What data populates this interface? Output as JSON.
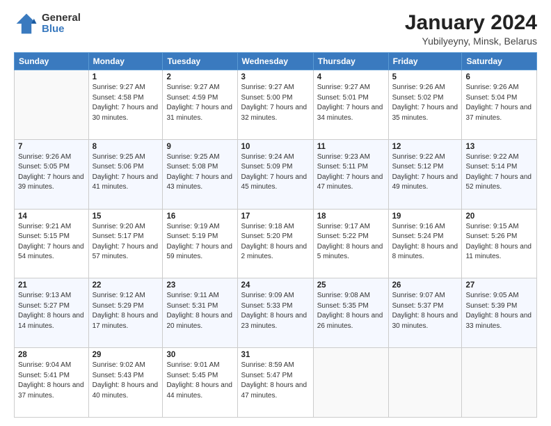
{
  "logo": {
    "general": "General",
    "blue": "Blue"
  },
  "header": {
    "title": "January 2024",
    "subtitle": "Yubilyeyny, Minsk, Belarus"
  },
  "weekdays": [
    "Sunday",
    "Monday",
    "Tuesday",
    "Wednesday",
    "Thursday",
    "Friday",
    "Saturday"
  ],
  "weeks": [
    [
      {
        "day": "",
        "sunrise": "",
        "sunset": "",
        "daylight": ""
      },
      {
        "day": "1",
        "sunrise": "Sunrise: 9:27 AM",
        "sunset": "Sunset: 4:58 PM",
        "daylight": "Daylight: 7 hours and 30 minutes."
      },
      {
        "day": "2",
        "sunrise": "Sunrise: 9:27 AM",
        "sunset": "Sunset: 4:59 PM",
        "daylight": "Daylight: 7 hours and 31 minutes."
      },
      {
        "day": "3",
        "sunrise": "Sunrise: 9:27 AM",
        "sunset": "Sunset: 5:00 PM",
        "daylight": "Daylight: 7 hours and 32 minutes."
      },
      {
        "day": "4",
        "sunrise": "Sunrise: 9:27 AM",
        "sunset": "Sunset: 5:01 PM",
        "daylight": "Daylight: 7 hours and 34 minutes."
      },
      {
        "day": "5",
        "sunrise": "Sunrise: 9:26 AM",
        "sunset": "Sunset: 5:02 PM",
        "daylight": "Daylight: 7 hours and 35 minutes."
      },
      {
        "day": "6",
        "sunrise": "Sunrise: 9:26 AM",
        "sunset": "Sunset: 5:04 PM",
        "daylight": "Daylight: 7 hours and 37 minutes."
      }
    ],
    [
      {
        "day": "7",
        "sunrise": "Sunrise: 9:26 AM",
        "sunset": "Sunset: 5:05 PM",
        "daylight": "Daylight: 7 hours and 39 minutes."
      },
      {
        "day": "8",
        "sunrise": "Sunrise: 9:25 AM",
        "sunset": "Sunset: 5:06 PM",
        "daylight": "Daylight: 7 hours and 41 minutes."
      },
      {
        "day": "9",
        "sunrise": "Sunrise: 9:25 AM",
        "sunset": "Sunset: 5:08 PM",
        "daylight": "Daylight: 7 hours and 43 minutes."
      },
      {
        "day": "10",
        "sunrise": "Sunrise: 9:24 AM",
        "sunset": "Sunset: 5:09 PM",
        "daylight": "Daylight: 7 hours and 45 minutes."
      },
      {
        "day": "11",
        "sunrise": "Sunrise: 9:23 AM",
        "sunset": "Sunset: 5:11 PM",
        "daylight": "Daylight: 7 hours and 47 minutes."
      },
      {
        "day": "12",
        "sunrise": "Sunrise: 9:22 AM",
        "sunset": "Sunset: 5:12 PM",
        "daylight": "Daylight: 7 hours and 49 minutes."
      },
      {
        "day": "13",
        "sunrise": "Sunrise: 9:22 AM",
        "sunset": "Sunset: 5:14 PM",
        "daylight": "Daylight: 7 hours and 52 minutes."
      }
    ],
    [
      {
        "day": "14",
        "sunrise": "Sunrise: 9:21 AM",
        "sunset": "Sunset: 5:15 PM",
        "daylight": "Daylight: 7 hours and 54 minutes."
      },
      {
        "day": "15",
        "sunrise": "Sunrise: 9:20 AM",
        "sunset": "Sunset: 5:17 PM",
        "daylight": "Daylight: 7 hours and 57 minutes."
      },
      {
        "day": "16",
        "sunrise": "Sunrise: 9:19 AM",
        "sunset": "Sunset: 5:19 PM",
        "daylight": "Daylight: 7 hours and 59 minutes."
      },
      {
        "day": "17",
        "sunrise": "Sunrise: 9:18 AM",
        "sunset": "Sunset: 5:20 PM",
        "daylight": "Daylight: 8 hours and 2 minutes."
      },
      {
        "day": "18",
        "sunrise": "Sunrise: 9:17 AM",
        "sunset": "Sunset: 5:22 PM",
        "daylight": "Daylight: 8 hours and 5 minutes."
      },
      {
        "day": "19",
        "sunrise": "Sunrise: 9:16 AM",
        "sunset": "Sunset: 5:24 PM",
        "daylight": "Daylight: 8 hours and 8 minutes."
      },
      {
        "day": "20",
        "sunrise": "Sunrise: 9:15 AM",
        "sunset": "Sunset: 5:26 PM",
        "daylight": "Daylight: 8 hours and 11 minutes."
      }
    ],
    [
      {
        "day": "21",
        "sunrise": "Sunrise: 9:13 AM",
        "sunset": "Sunset: 5:27 PM",
        "daylight": "Daylight: 8 hours and 14 minutes."
      },
      {
        "day": "22",
        "sunrise": "Sunrise: 9:12 AM",
        "sunset": "Sunset: 5:29 PM",
        "daylight": "Daylight: 8 hours and 17 minutes."
      },
      {
        "day": "23",
        "sunrise": "Sunrise: 9:11 AM",
        "sunset": "Sunset: 5:31 PM",
        "daylight": "Daylight: 8 hours and 20 minutes."
      },
      {
        "day": "24",
        "sunrise": "Sunrise: 9:09 AM",
        "sunset": "Sunset: 5:33 PM",
        "daylight": "Daylight: 8 hours and 23 minutes."
      },
      {
        "day": "25",
        "sunrise": "Sunrise: 9:08 AM",
        "sunset": "Sunset: 5:35 PM",
        "daylight": "Daylight: 8 hours and 26 minutes."
      },
      {
        "day": "26",
        "sunrise": "Sunrise: 9:07 AM",
        "sunset": "Sunset: 5:37 PM",
        "daylight": "Daylight: 8 hours and 30 minutes."
      },
      {
        "day": "27",
        "sunrise": "Sunrise: 9:05 AM",
        "sunset": "Sunset: 5:39 PM",
        "daylight": "Daylight: 8 hours and 33 minutes."
      }
    ],
    [
      {
        "day": "28",
        "sunrise": "Sunrise: 9:04 AM",
        "sunset": "Sunset: 5:41 PM",
        "daylight": "Daylight: 8 hours and 37 minutes."
      },
      {
        "day": "29",
        "sunrise": "Sunrise: 9:02 AM",
        "sunset": "Sunset: 5:43 PM",
        "daylight": "Daylight: 8 hours and 40 minutes."
      },
      {
        "day": "30",
        "sunrise": "Sunrise: 9:01 AM",
        "sunset": "Sunset: 5:45 PM",
        "daylight": "Daylight: 8 hours and 44 minutes."
      },
      {
        "day": "31",
        "sunrise": "Sunrise: 8:59 AM",
        "sunset": "Sunset: 5:47 PM",
        "daylight": "Daylight: 8 hours and 47 minutes."
      },
      {
        "day": "",
        "sunrise": "",
        "sunset": "",
        "daylight": ""
      },
      {
        "day": "",
        "sunrise": "",
        "sunset": "",
        "daylight": ""
      },
      {
        "day": "",
        "sunrise": "",
        "sunset": "",
        "daylight": ""
      }
    ]
  ]
}
